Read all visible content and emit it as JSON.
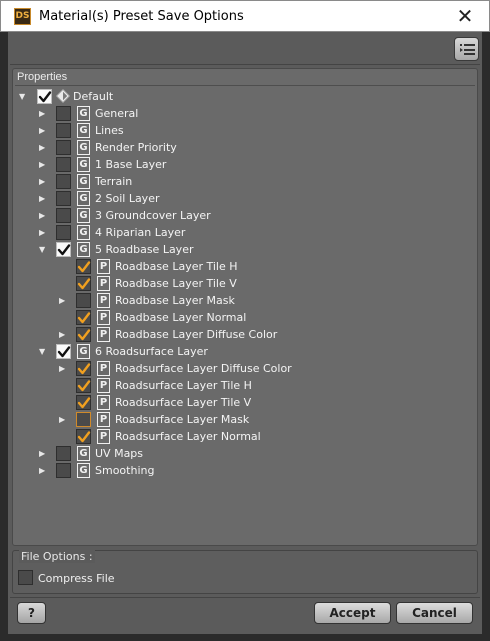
{
  "window": {
    "title": "Material(s) Preset Save Options",
    "app_icon_text": "DS",
    "close_glyph": "✕"
  },
  "properties": {
    "heading": "Properties",
    "tree": [
      {
        "label": "Default",
        "level": 0,
        "expanded": true,
        "checkbox": "checked",
        "icon": "default-icon"
      },
      {
        "label": "General",
        "level": 1,
        "expanded": false,
        "checkbox": "unchecked",
        "icon": "G"
      },
      {
        "label": "Lines",
        "level": 1,
        "expanded": false,
        "checkbox": "unchecked",
        "icon": "G"
      },
      {
        "label": "Render Priority",
        "level": 1,
        "expanded": false,
        "checkbox": "unchecked",
        "icon": "G"
      },
      {
        "label": "1 Base Layer",
        "level": 1,
        "expanded": false,
        "checkbox": "unchecked",
        "icon": "G"
      },
      {
        "label": "Terrain",
        "level": 1,
        "expanded": false,
        "checkbox": "unchecked",
        "icon": "G"
      },
      {
        "label": "2 Soil Layer",
        "level": 1,
        "expanded": false,
        "checkbox": "unchecked",
        "icon": "G"
      },
      {
        "label": "3 Groundcover Layer",
        "level": 1,
        "expanded": false,
        "checkbox": "unchecked",
        "icon": "G"
      },
      {
        "label": "4 Riparian Layer",
        "level": 1,
        "expanded": false,
        "checkbox": "unchecked",
        "icon": "G"
      },
      {
        "label": "5 Roadbase Layer",
        "level": 1,
        "expanded": true,
        "checkbox": "checked",
        "icon": "G"
      },
      {
        "label": "Roadbase Layer Tile H",
        "level": 2,
        "expandable": false,
        "checkbox": "checked-orange",
        "icon": "P"
      },
      {
        "label": "Roadbase Layer Tile V",
        "level": 2,
        "expandable": false,
        "checkbox": "checked-orange",
        "icon": "P"
      },
      {
        "label": "Roadbase Layer Mask",
        "level": 2,
        "expandable": true,
        "expanded": false,
        "checkbox": "unchecked",
        "icon": "P"
      },
      {
        "label": "Roadbase Layer Normal",
        "level": 2,
        "expandable": false,
        "checkbox": "checked-orange",
        "icon": "P"
      },
      {
        "label": "Roadbase Layer Diffuse Color",
        "level": 2,
        "expandable": true,
        "expanded": false,
        "checkbox": "checked-orange",
        "icon": "P"
      },
      {
        "label": "6 Roadsurface Layer",
        "level": 1,
        "expanded": true,
        "checkbox": "checked",
        "icon": "G"
      },
      {
        "label": "Roadsurface Layer Diffuse Color",
        "level": 2,
        "expandable": true,
        "expanded": false,
        "checkbox": "checked-orange",
        "icon": "P"
      },
      {
        "label": "Roadsurface Layer Tile H",
        "level": 2,
        "expandable": false,
        "checkbox": "checked-orange",
        "icon": "P"
      },
      {
        "label": "Roadsurface Layer Tile V",
        "level": 2,
        "expandable": false,
        "checkbox": "checked-orange",
        "icon": "P"
      },
      {
        "label": "Roadsurface Layer Mask",
        "level": 2,
        "expandable": true,
        "expanded": false,
        "checkbox": "unchecked-orange",
        "icon": "P"
      },
      {
        "label": "Roadsurface Layer Normal",
        "level": 2,
        "expandable": false,
        "checkbox": "checked-orange",
        "icon": "P"
      },
      {
        "label": "UV Maps",
        "level": 1,
        "expanded": false,
        "checkbox": "unchecked",
        "icon": "G"
      },
      {
        "label": "Smoothing",
        "level": 1,
        "expanded": false,
        "checkbox": "unchecked",
        "icon": "G"
      }
    ]
  },
  "file_options": {
    "heading": "File Options :",
    "compress_label": "Compress File",
    "compress_checked": false
  },
  "buttons": {
    "help": "?",
    "accept": "Accept",
    "cancel": "Cancel"
  },
  "colors": {
    "check_orange": "#f0a020",
    "check_white": "#111111",
    "panel_bg": "#5b5b5b"
  }
}
